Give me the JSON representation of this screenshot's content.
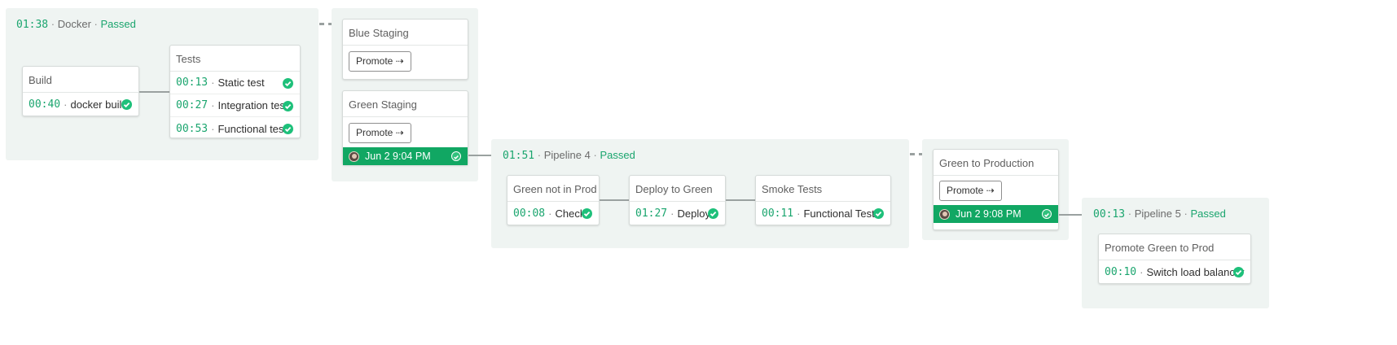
{
  "docker_group": {
    "duration": "01:38",
    "name": "Docker",
    "status": "Passed",
    "build": {
      "title": "Build",
      "jobs": [
        {
          "duration": "00:40",
          "name": "docker build"
        }
      ]
    },
    "tests": {
      "title": "Tests",
      "jobs": [
        {
          "duration": "00:13",
          "name": "Static test"
        },
        {
          "duration": "00:27",
          "name": "Integration test"
        },
        {
          "duration": "00:53",
          "name": "Functional test"
        }
      ]
    }
  },
  "staging_group": {
    "blue": {
      "title": "Blue Staging",
      "promote_label": "Promote ⇢"
    },
    "green": {
      "title": "Green Staging",
      "promote_label": "Promote ⇢",
      "approved_at": "Jun 2 9:04 PM"
    }
  },
  "pipeline4": {
    "duration": "01:51",
    "name": "Pipeline 4",
    "status": "Passed",
    "stages": [
      {
        "title": "Green not in Prod",
        "duration": "00:08",
        "job": "Check"
      },
      {
        "title": "Deploy to Green",
        "duration": "01:27",
        "job": "Deploy"
      },
      {
        "title": "Smoke Tests",
        "duration": "00:11",
        "job": "Functional Tests"
      }
    ]
  },
  "production_group": {
    "title": "Green to Production",
    "promote_label": "Promote ⇢",
    "approved_at": "Jun 2 9:08 PM"
  },
  "pipeline5": {
    "duration": "00:13",
    "name": "Pipeline 5",
    "status": "Passed",
    "stage": {
      "title": "Promote Green to Prod",
      "duration": "00:10",
      "job": "Switch load balancer"
    }
  },
  "colors": {
    "passed": "#1aa56e",
    "approved_bar": "#11a763",
    "group_bg": "#eff4f2",
    "check": "#1ec07a"
  },
  "icons": {
    "check": "check-circle-icon",
    "avatar": "user-avatar",
    "arrow": "dashed-arrow-right-icon"
  }
}
